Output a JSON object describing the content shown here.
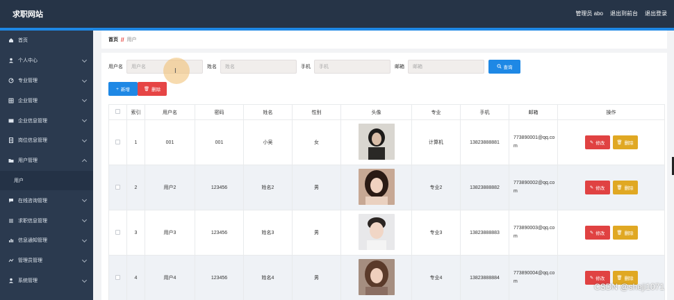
{
  "app": {
    "logo": "求职网站"
  },
  "topbar": {
    "user": "管理员 abo",
    "back_to_front": "退出到前台",
    "logout": "退出登录"
  },
  "sidebar": {
    "items": [
      {
        "label": "首页",
        "icon": "home-icon"
      },
      {
        "label": "个人中心",
        "icon": "user-icon"
      },
      {
        "label": "专业管理",
        "icon": "book-icon"
      },
      {
        "label": "企业管理",
        "icon": "building-icon"
      },
      {
        "label": "企业信息管理",
        "icon": "card-icon"
      },
      {
        "label": "岗位信息管理",
        "icon": "doc-icon"
      },
      {
        "label": "用户管理",
        "icon": "folder-icon"
      },
      {
        "label": "用户",
        "icon": ""
      },
      {
        "label": "在线咨询管理",
        "icon": "chat-icon"
      },
      {
        "label": "求职信息管理",
        "icon": "list-icon"
      },
      {
        "label": "信息通知管理",
        "icon": "bar-icon"
      },
      {
        "label": "管理员管理",
        "icon": "admin-icon"
      },
      {
        "label": "系统管理",
        "icon": "gear-icon"
      }
    ]
  },
  "breadcrumb": {
    "home": "首页",
    "sep": "//",
    "current": "用户"
  },
  "search": {
    "username_label": "用户名",
    "username_placeholder": "用户名",
    "name_label": "姓名",
    "name_placeholder": "姓名",
    "phone_label": "手机",
    "phone_placeholder": "手机",
    "email_label": "邮箱",
    "email_placeholder": "邮箱",
    "button": "查询"
  },
  "actions": {
    "add": "新增",
    "delete": "删除"
  },
  "table": {
    "headers": [
      "",
      "索引",
      "用户名",
      "密码",
      "姓名",
      "性别",
      "头像",
      "专业",
      "手机",
      "邮箱",
      "操作"
    ],
    "rows": [
      {
        "index": "1",
        "username": "001",
        "password": "001",
        "name": "小吴",
        "gender": "女",
        "major": "计算机",
        "phone": "13823888881",
        "email": "773890001@qq.com"
      },
      {
        "index": "2",
        "username": "用户2",
        "password": "123456",
        "name": "姓名2",
        "gender": "男",
        "major": "专业2",
        "phone": "13823888882",
        "email": "773890002@qq.com"
      },
      {
        "index": "3",
        "username": "用户3",
        "password": "123456",
        "name": "姓名3",
        "gender": "男",
        "major": "专业3",
        "phone": "13823888883",
        "email": "773890003@qq.com"
      },
      {
        "index": "4",
        "username": "用户4",
        "password": "123456",
        "name": "姓名4",
        "gender": "男",
        "major": "专业4",
        "phone": "13823888884",
        "email": "773890004@qq.com"
      }
    ],
    "edit_label": "修改",
    "delete_label": "删除"
  },
  "watermark": "CSDN @sheji1071",
  "colors": {
    "topbar": "#263447",
    "sidebar": "#2b3a4f",
    "primary": "#1e88e5",
    "danger": "#e04242",
    "warning": "#e0a823"
  }
}
